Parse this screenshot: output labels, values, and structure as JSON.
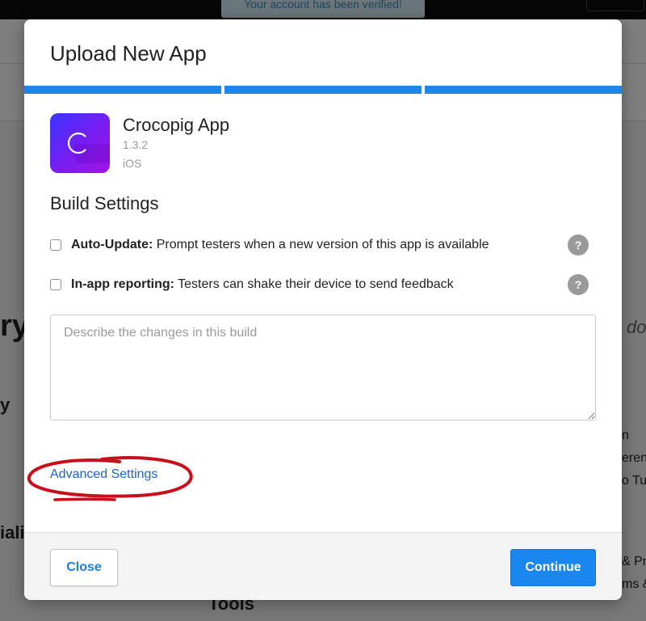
{
  "background": {
    "banner_text": "Your account has been verified!",
    "fragments": {
      "left_ry": "ry",
      "left_y": "y",
      "left_iali": "iali",
      "right_dov": "dov",
      "right_n": "n",
      "right_erenc": "erenc",
      "right_o_tu": "o Tu",
      "right_and_pr": "& Pr",
      "right_ms_and": "ms &",
      "tools": "Tools"
    }
  },
  "modal": {
    "title": "Upload New App",
    "progress_steps": 3,
    "progress_complete": 3,
    "accent_color": "#1f86e8",
    "app": {
      "name": "Crocopig App",
      "version": "1.3.2",
      "platform": "iOS",
      "icon": "app-logo-c-icon"
    },
    "build_settings": {
      "title": "Build Settings",
      "options": [
        {
          "label": "Auto-Update:",
          "description": " Prompt testers when a new version of this app is available",
          "checked": false,
          "help": "?"
        },
        {
          "label": "In-app reporting:",
          "description": " Testers can shake their device to send feedback",
          "checked": false,
          "help": "?"
        }
      ],
      "notes_placeholder": "Describe the changes in this build",
      "notes_value": ""
    },
    "advanced_settings_link": "Advanced Settings",
    "annotation_color": "#c8101c",
    "footer": {
      "close_label": "Close",
      "continue_label": "Continue"
    }
  }
}
